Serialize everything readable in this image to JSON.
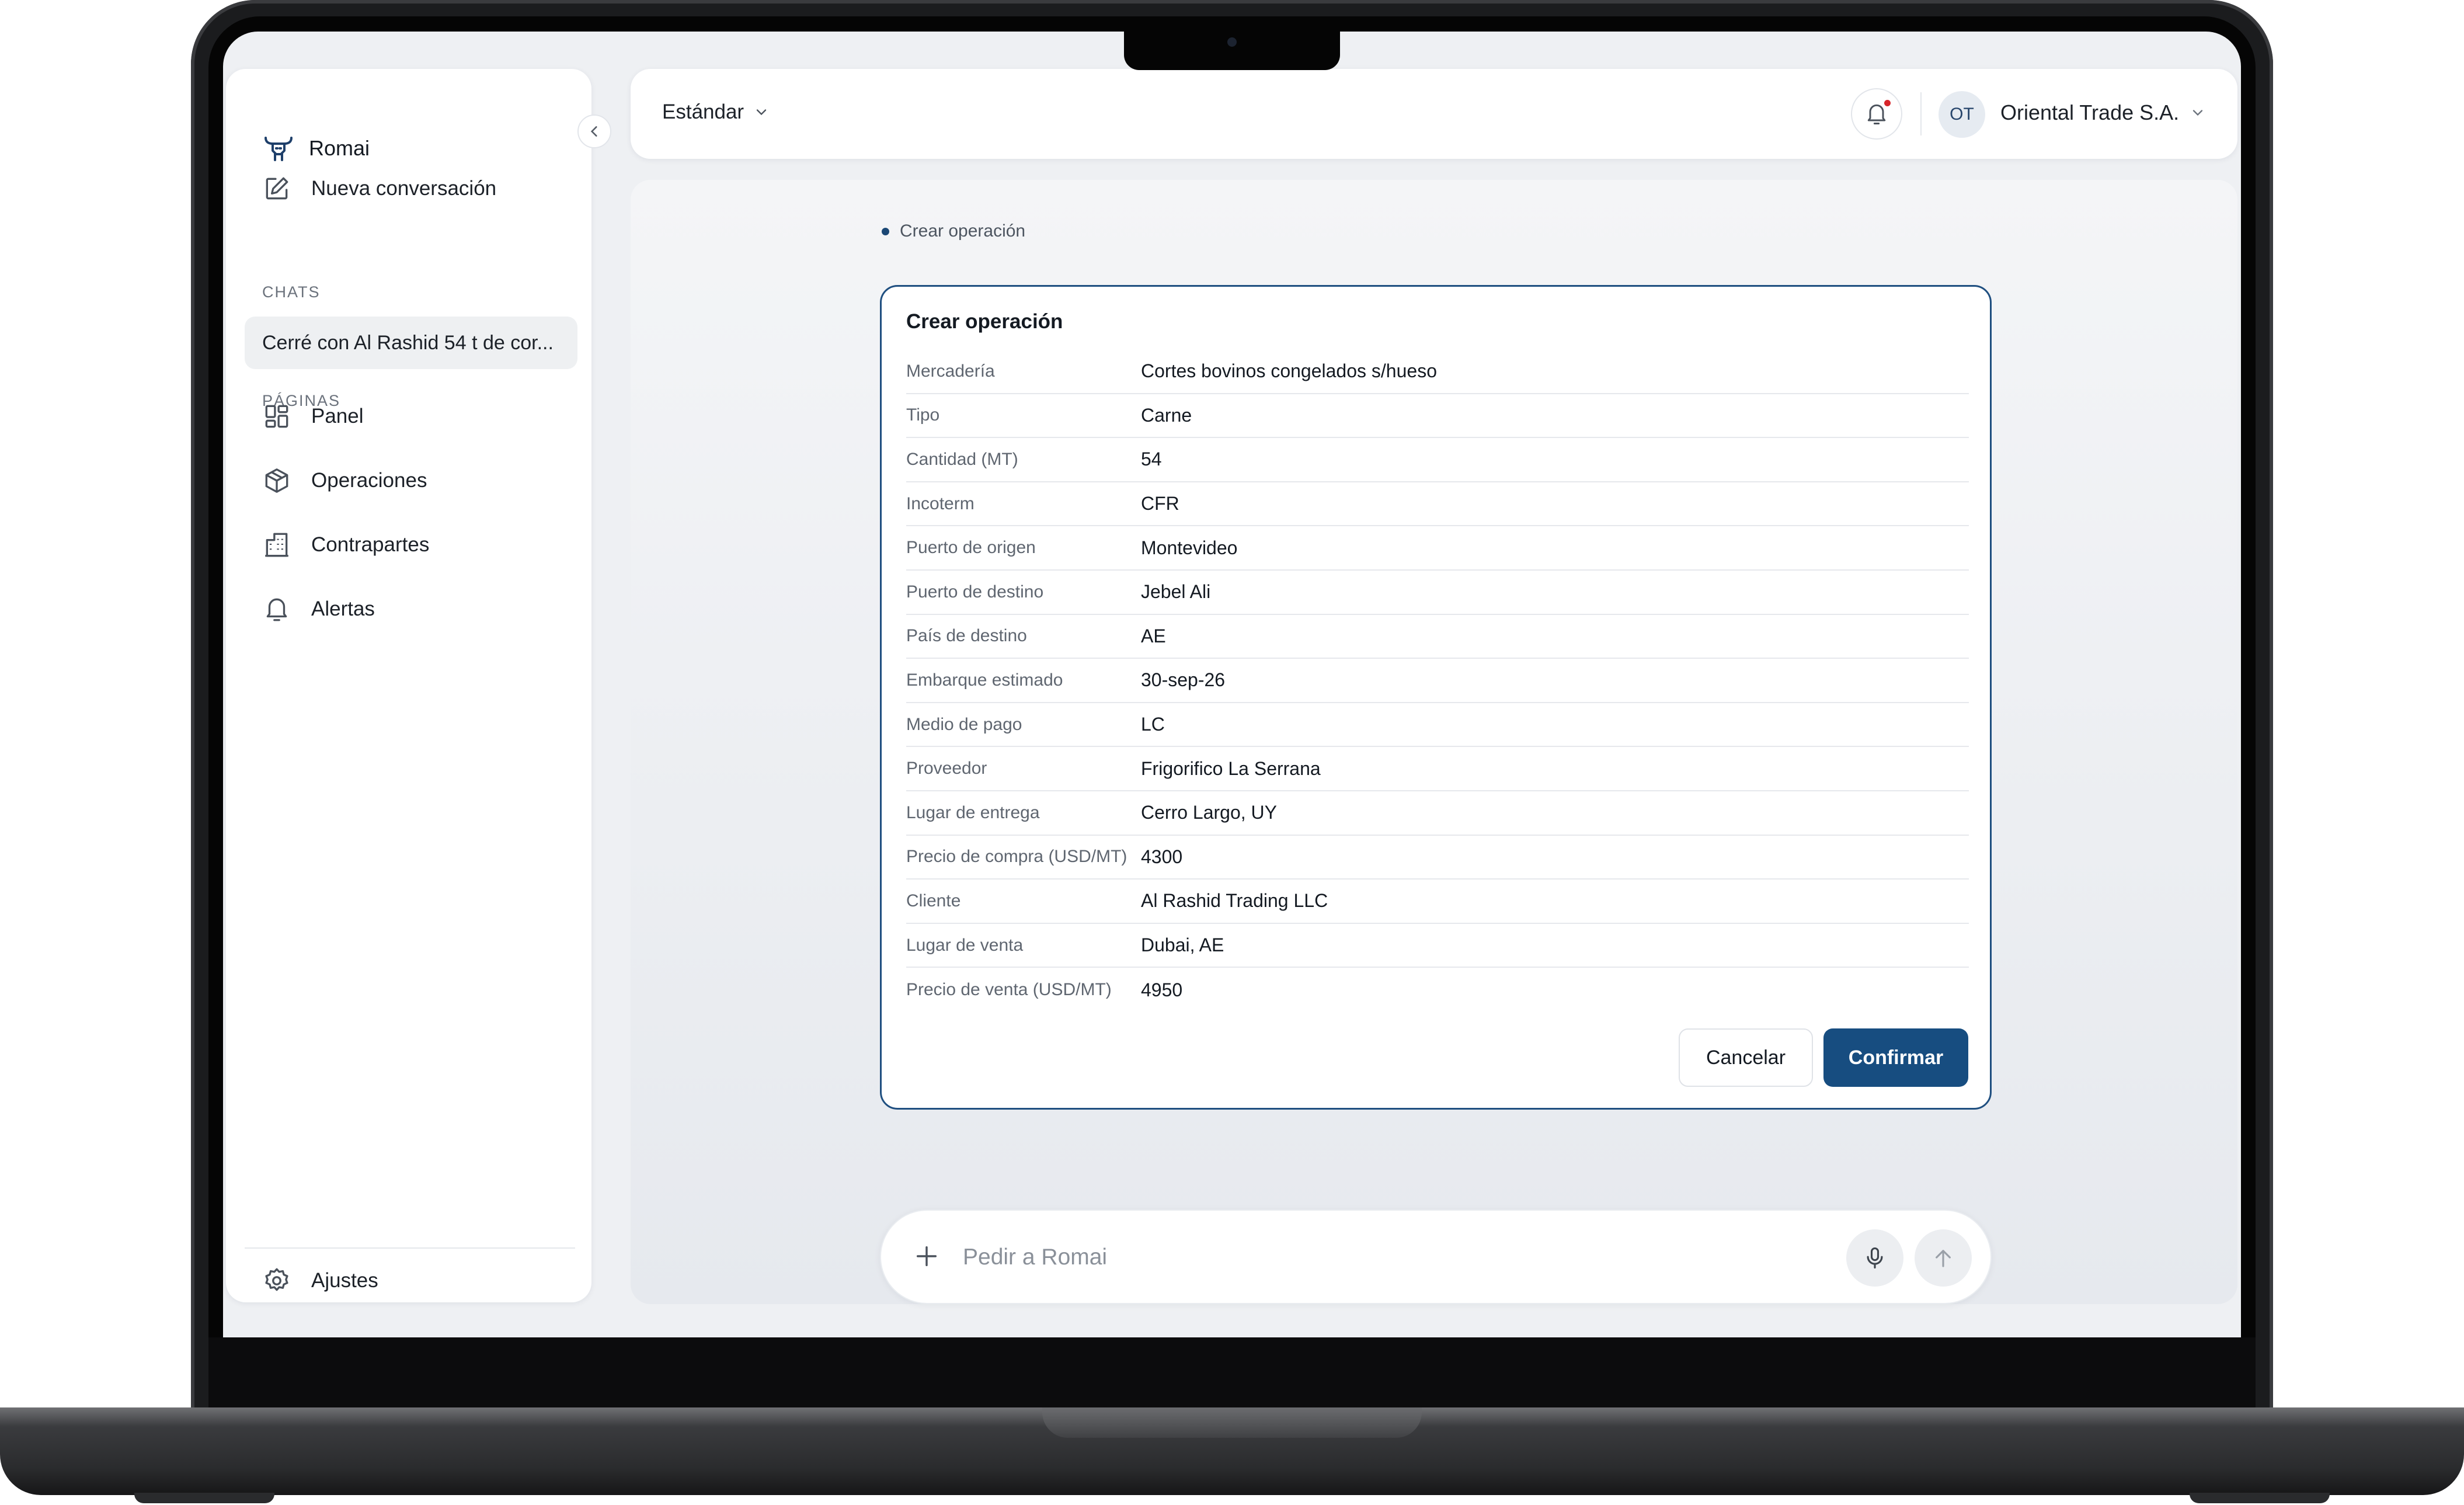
{
  "app": {
    "name": "Romai"
  },
  "sidebar": {
    "new_chat_label": "Nueva conversación",
    "chats_heading": "CHATS",
    "chats": [
      {
        "label": "Cerré con Al Rashid 54 t de cor..."
      }
    ],
    "pages_heading": "PÁGINAS",
    "pages": [
      {
        "label": "Panel",
        "icon": "grid-icon"
      },
      {
        "label": "Operaciones",
        "icon": "package-icon"
      },
      {
        "label": "Contrapartes",
        "icon": "building-icon"
      },
      {
        "label": "Alertas",
        "icon": "bell-icon"
      }
    ],
    "settings_label": "Ajustes"
  },
  "topbar": {
    "mode_label": "Estándar",
    "avatar_initials": "OT",
    "org_name": "Oriental Trade S.A."
  },
  "status": {
    "text": "Crear operación"
  },
  "form": {
    "title": "Crear operación",
    "rows": [
      {
        "label": "Mercadería",
        "value": "Cortes bovinos congelados s/hueso"
      },
      {
        "label": "Tipo",
        "value": "Carne"
      },
      {
        "label": "Cantidad (MT)",
        "value": "54"
      },
      {
        "label": "Incoterm",
        "value": "CFR"
      },
      {
        "label": "Puerto de origen",
        "value": "Montevideo"
      },
      {
        "label": "Puerto de destino",
        "value": "Jebel Ali"
      },
      {
        "label": "País de destino",
        "value": "AE"
      },
      {
        "label": "Embarque estimado",
        "value": "30-sep-26"
      },
      {
        "label": "Medio de pago",
        "value": "LC"
      },
      {
        "label": "Proveedor",
        "value": "Frigorifico La Serrana"
      },
      {
        "label": "Lugar de entrega",
        "value": "Cerro Largo, UY"
      },
      {
        "label": "Precio de compra (USD/MT)",
        "value": "4300"
      },
      {
        "label": "Cliente",
        "value": "Al Rashid Trading LLC"
      },
      {
        "label": "Lugar de venta",
        "value": "Dubai, AE"
      },
      {
        "label": "Precio de venta (USD/MT)",
        "value": "4950"
      }
    ],
    "cancel_label": "Cancelar",
    "confirm_label": "Confirmar"
  },
  "composer": {
    "placeholder": "Pedir a Romai",
    "value": ""
  },
  "colors": {
    "accent": "#174d80",
    "notification_dot": "#d8262b",
    "background": "#eef0f3"
  }
}
